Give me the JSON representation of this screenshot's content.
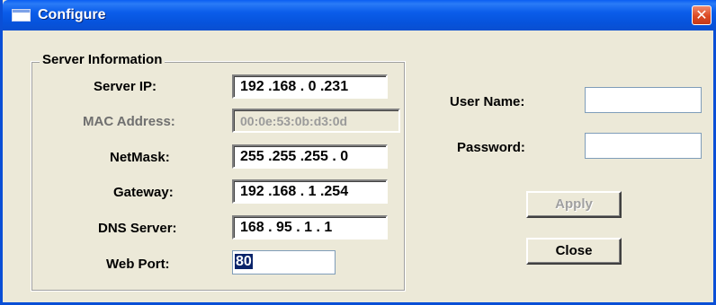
{
  "window": {
    "title": "Configure",
    "close_glyph": "✕"
  },
  "server_info": {
    "group_label": "Server Information",
    "server_ip": {
      "label": "Server IP:",
      "value": "192 .168 .  0  .231"
    },
    "mac_address": {
      "label": "MAC Address:",
      "value": "00:0e:53:0b:d3:0d"
    },
    "netmask": {
      "label": "NetMask:",
      "value": "255 .255 .255 .  0"
    },
    "gateway": {
      "label": "Gateway:",
      "value": "192 .168 .  1  .254"
    },
    "dns_server": {
      "label": "DNS Server:",
      "value": "168 . 95  .  1  .  1"
    },
    "web_port": {
      "label": "Web Port:",
      "value": "80"
    }
  },
  "auth": {
    "username": {
      "label": "User Name:",
      "value": ""
    },
    "password": {
      "label": "Password:",
      "value": ""
    }
  },
  "buttons": {
    "apply": "Apply",
    "close": "Close"
  },
  "icons": {
    "title_icon": "window-icon",
    "close_icon": "close-icon"
  },
  "colors": {
    "titlebar": "#0A5FF2",
    "dialog_bg": "#ECE9D8",
    "close_button": "#DC4A23",
    "selection": "#0A246A"
  }
}
